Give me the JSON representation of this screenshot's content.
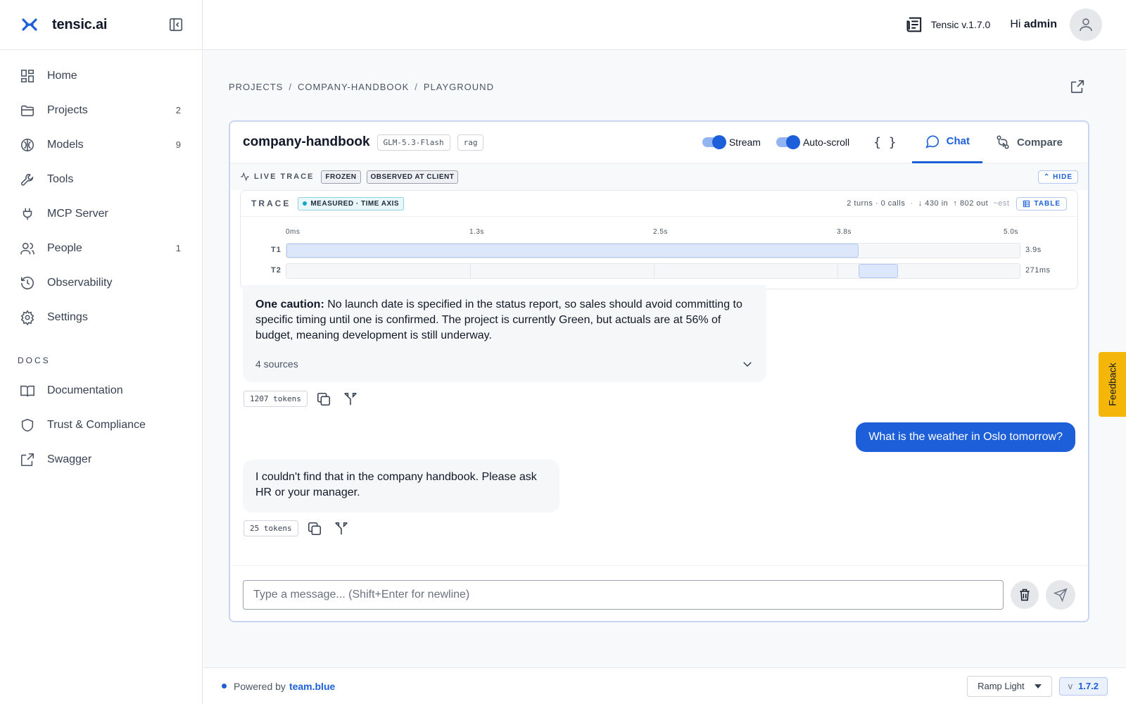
{
  "app": {
    "name": "tensic.ai",
    "version_label": "Tensic v.1.7.0",
    "greeting_prefix": "Hi",
    "user": "admin"
  },
  "sidebar": {
    "items": [
      {
        "label": "Home",
        "count": "",
        "icon": "grid-icon"
      },
      {
        "label": "Projects",
        "count": "2",
        "icon": "folder-icon"
      },
      {
        "label": "Models",
        "count": "9",
        "icon": "brain-icon"
      },
      {
        "label": "Tools",
        "count": "",
        "icon": "wrench-icon"
      },
      {
        "label": "MCP Server",
        "count": "",
        "icon": "plug-icon"
      },
      {
        "label": "People",
        "count": "1",
        "icon": "users-icon"
      },
      {
        "label": "Observability",
        "count": "",
        "icon": "history-icon"
      },
      {
        "label": "Settings",
        "count": "",
        "icon": "gear-icon"
      }
    ],
    "docs_heading": "DOCS",
    "docs": [
      {
        "label": "Documentation",
        "icon": "book-icon"
      },
      {
        "label": "Trust & Compliance",
        "icon": "shield-icon"
      },
      {
        "label": "Swagger",
        "icon": "external-link-icon"
      }
    ]
  },
  "breadcrumb": {
    "a": "PROJECTS",
    "b": "COMPANY-HANDBOOK",
    "c": "PLAYGROUND",
    "sep": "/"
  },
  "panel": {
    "title": "company-handbook",
    "model_tag": "GLM-5.3-Flash",
    "mode_tag": "rag",
    "stream_label": "Stream",
    "autoscroll_label": "Auto-scroll",
    "braces": "{ }",
    "tab_chat": "Chat",
    "tab_compare": "Compare"
  },
  "live_trace": {
    "label": "LIVE TRACE",
    "chip_frozen": "FROZEN",
    "chip_observed": "OBSERVED AT CLIENT",
    "hide": "HIDE"
  },
  "trace": {
    "title": "TRACE",
    "measured": "MEASURED · TIME AXIS",
    "stats": "2 turns · 0 calls",
    "stats_sep": "·",
    "tokens_in": "↓ 430 in",
    "tokens_out": "↑ 802 out",
    "est": "~est",
    "table": "TABLE",
    "ticks": [
      "0ms",
      "1.3s",
      "2.5s",
      "3.8s",
      "5.0s"
    ],
    "axis_max_s": 5.0,
    "turns": [
      {
        "label": "T1",
        "start_s": 0.0,
        "end_s": 3.9,
        "duration": "3.9s"
      },
      {
        "label": "T2",
        "start_s": 3.9,
        "end_s": 4.171,
        "duration": "271ms"
      }
    ]
  },
  "chat": {
    "msg1_bold": "One caution:",
    "msg1_text": " No launch date is specified in the status report, so sales should avoid committing to specific timing until one is confirmed. The project is currently Green, but actuals are at 56% of budget, meaning development is still underway.",
    "msg1_sources": "4 sources",
    "msg1_tokens": "1207 tokens",
    "user_msg": "What is the weather in Oslo tomorrow?",
    "msg2_text": "I couldn't find that in the company handbook. Please ask HR or your manager.",
    "msg2_tokens": "25 tokens"
  },
  "composer": {
    "placeholder": "Type a message... (Shift+Enter for newline)"
  },
  "feedback": "Feedback",
  "footer": {
    "powered": "Powered by",
    "link": "team.blue",
    "theme": "Ramp Light",
    "v": "v",
    "version": "1.7.2"
  },
  "colors": {
    "accent": "#1d5fd8",
    "feedback": "#f5b60a"
  }
}
